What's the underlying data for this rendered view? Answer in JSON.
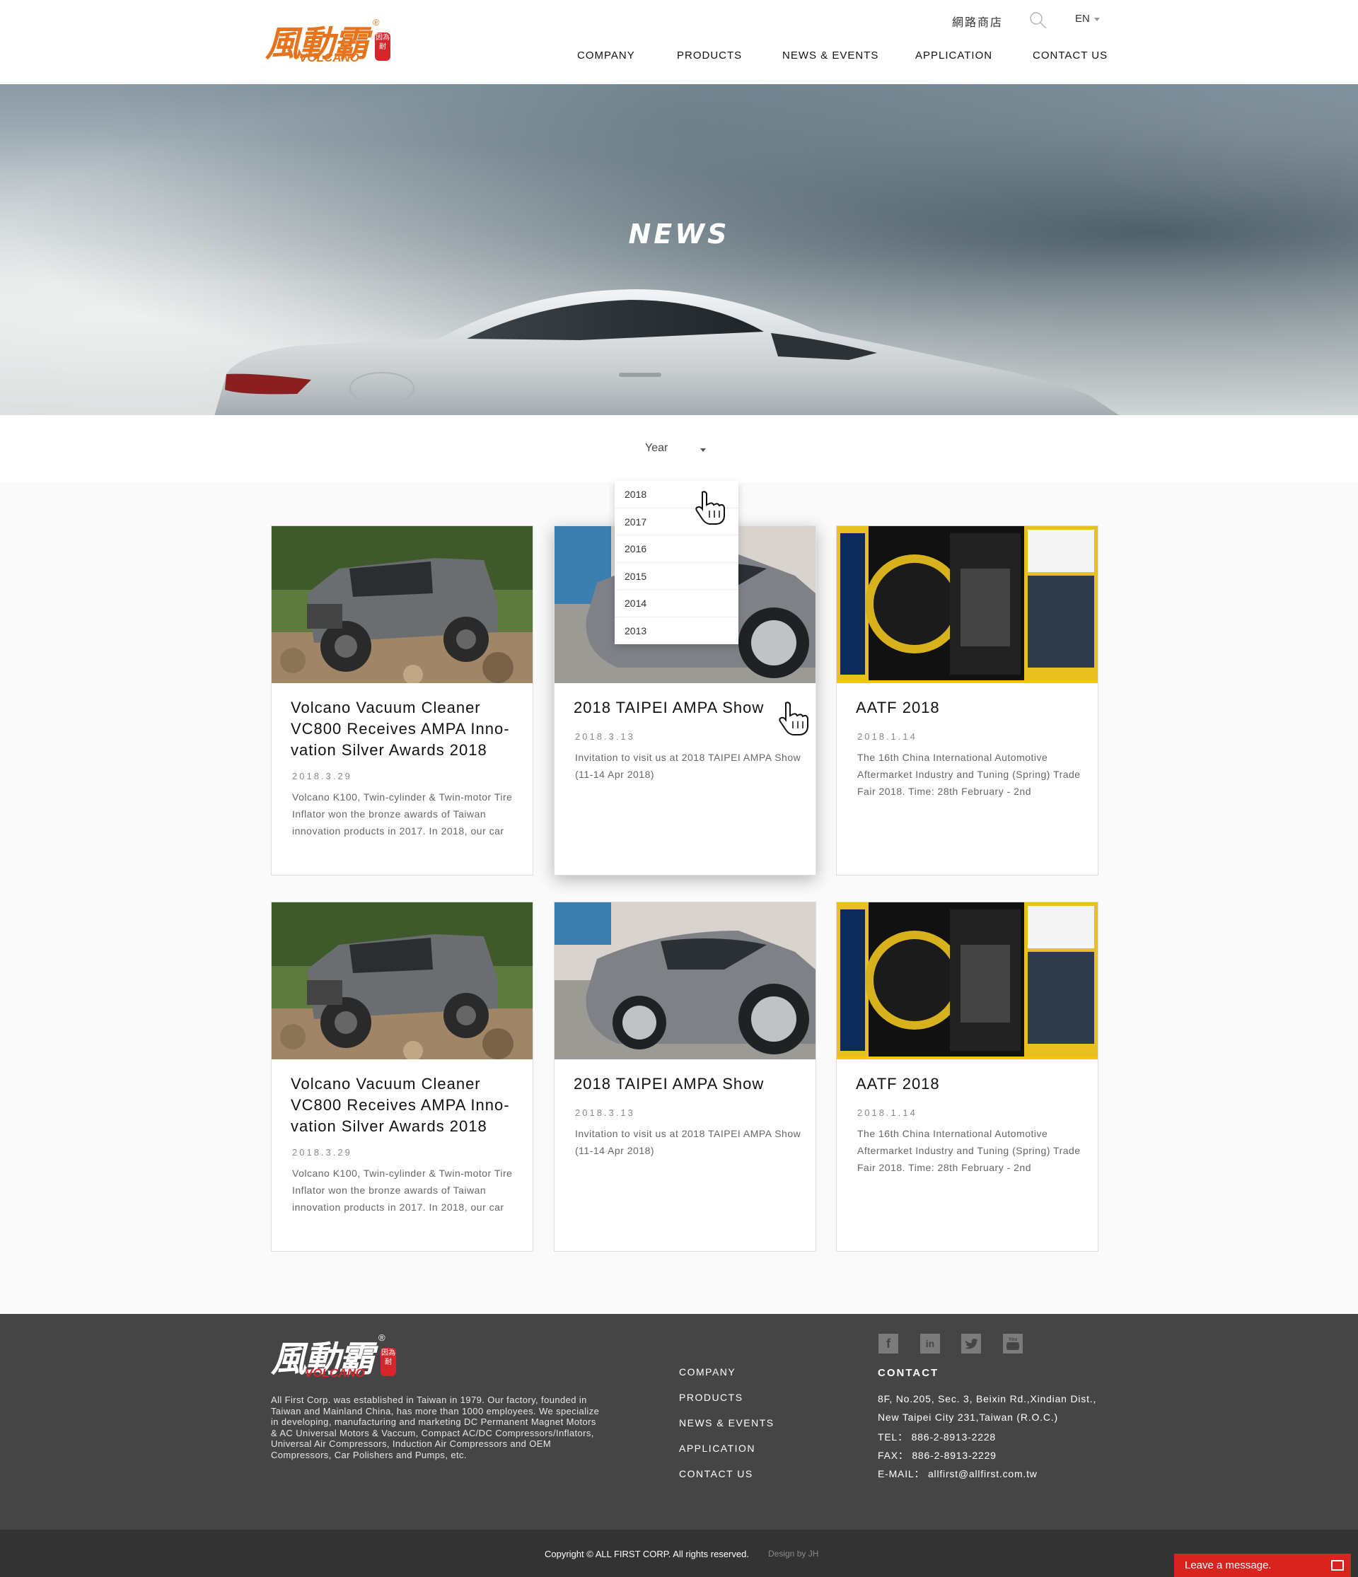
{
  "header": {
    "logo_cn": "風動霸",
    "logo_en": "VOLCANO",
    "logo_seal": "因為耐",
    "logo_reg": "®",
    "shop_link": "網路商店",
    "search_icon": "search-icon",
    "language": "EN",
    "nav": [
      {
        "label": "COMPANY"
      },
      {
        "label": "PRODUCTS"
      },
      {
        "label": "NEWS & EVENTS"
      },
      {
        "label": "APPLICATION"
      },
      {
        "label": "CONTACT US"
      }
    ]
  },
  "hero": {
    "title": "NEWS"
  },
  "filter": {
    "label": "Year",
    "options": [
      "2018",
      "2017",
      "2016",
      "2015",
      "2014",
      "2013"
    ]
  },
  "cards": [
    {
      "title": "Volcano Vacuum Cleaner VC800 Receives AMPA Inno-vation Silver Awards 2018",
      "date": "2018.3.29",
      "excerpt": "Volcano K100, Twin-cylinder & Twin-motor Tire Inflator won the bronze awards of Taiwan innovation products in 2017. In 2018, our car",
      "image": "jeep-photo"
    },
    {
      "title": "2018 TAIPEI AMPA Show",
      "date": "2018.3.13",
      "excerpt": "Invitation to visit us at 2018 TAIPEI AMPA Show (11-14 Apr 2018)",
      "image": "silver-car-photo"
    },
    {
      "title": "AATF 2018",
      "date": "2018.1.14",
      "excerpt": "The 16th China International Automotive Aftermarket Industry and Tuning (Spring) Trade Fair 2018. Time: 28th February - 2nd",
      "image": "booth-display-photo"
    },
    {
      "title": "Volcano Vacuum Cleaner VC800 Receives AMPA Inno-vation Silver Awards 2018",
      "date": "2018.3.29",
      "excerpt": "Volcano K100, Twin-cylinder & Twin-motor Tire Inflator won the bronze awards of Taiwan innovation products in 2017. In 2018, our car",
      "image": "jeep-photo"
    },
    {
      "title": "2018 TAIPEI AMPA Show",
      "date": "2018.3.13",
      "excerpt": "Invitation to visit us at 2018 TAIPEI AMPA Show (11-14 Apr 2018)",
      "image": "silver-car-photo"
    },
    {
      "title": "AATF 2018",
      "date": "2018.1.14",
      "excerpt": "The 16th China International Automotive Aftermarket Industry and Tuning (Spring) Trade Fair 2018. Time: 28th February - 2nd",
      "image": "booth-display-photo"
    }
  ],
  "footer": {
    "about": "All First Corp. was established in Taiwan in 1979. Our factory, founded in Taiwan and Mainland China, has more than 1000 employees. We specialize in developing, manufacturing and marketing DC Permanent Magnet Motors & AC Universal Motors & Vaccum, Compact AC/DC Compressors/Inflators, Universal Air Compressors, Induction Air Compressors and OEM Compressors, Car Polishers and Pumps, etc.",
    "nav": [
      "COMPANY",
      "PRODUCTS",
      "NEWS & EVENTS",
      "APPLICATION",
      "CONTACT US"
    ],
    "social": [
      "facebook-icon",
      "linkedin-icon",
      "twitter-icon",
      "youtube-icon"
    ],
    "contact_title": "CONTACT",
    "address_1": "8F, No.205, Sec. 3, Beixin Rd.,Xindian Dist.,",
    "address_2": "New Taipei City 231,Taiwan (R.O.C.)",
    "tel": "TEL： 886-2-8913-2228",
    "fax": "FAX： 886-2-8913-2229",
    "email": "E-MAIL： allfirst@allfirst.com.tw",
    "copyright": "Copyright © ALL FIRST CORP. All rights reserved.",
    "design_by": "Design by JH",
    "leave_message": "Leave a message."
  },
  "colors": {
    "brand_orange": "#e8731d",
    "brand_red": "#d6262b",
    "footer_bg": "#454545",
    "bottom_bar_bg": "#333333",
    "chat_red": "#d9231f"
  }
}
